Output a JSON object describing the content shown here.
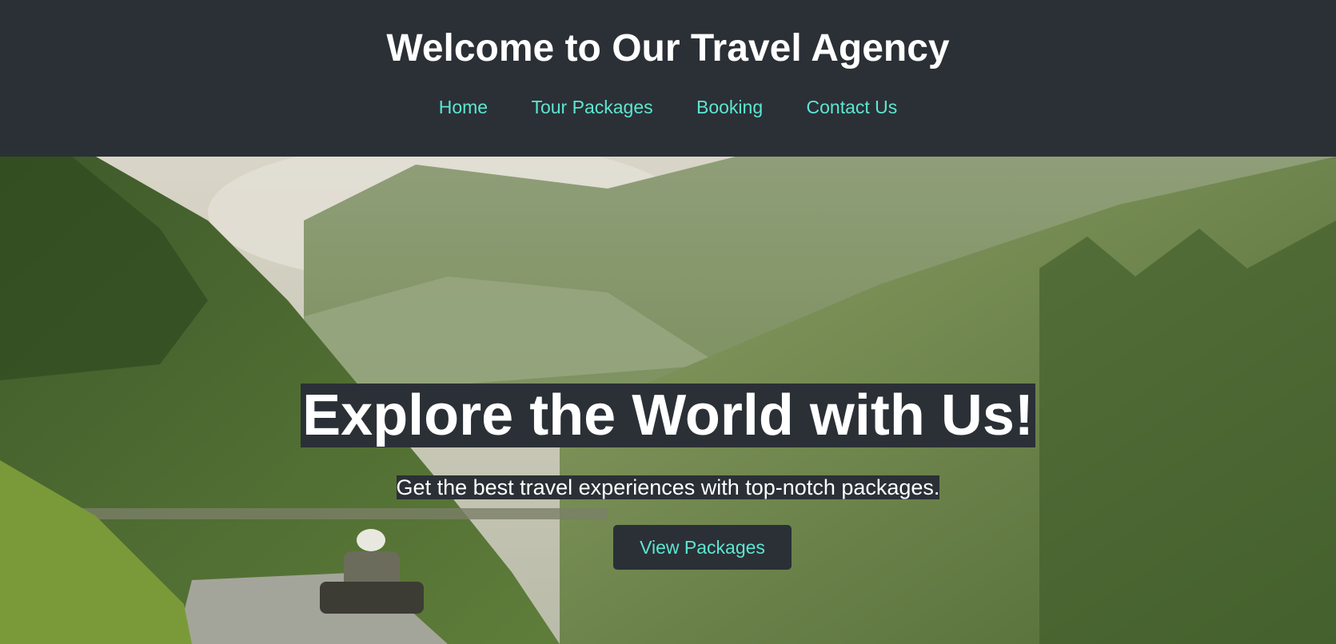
{
  "header": {
    "title": "Welcome to Our Travel Agency",
    "nav": [
      {
        "label": "Home"
      },
      {
        "label": "Tour Packages"
      },
      {
        "label": "Booking"
      },
      {
        "label": "Contact Us"
      }
    ]
  },
  "hero": {
    "title": "Explore the World with Us!",
    "subtitle": "Get the best travel experiences with top-notch packages.",
    "cta_label": "View Packages",
    "background": "mountain-valley-photo"
  },
  "colors": {
    "header_bg": "#2b3036",
    "accent": "#5ce6d2",
    "text": "#ffffff"
  }
}
